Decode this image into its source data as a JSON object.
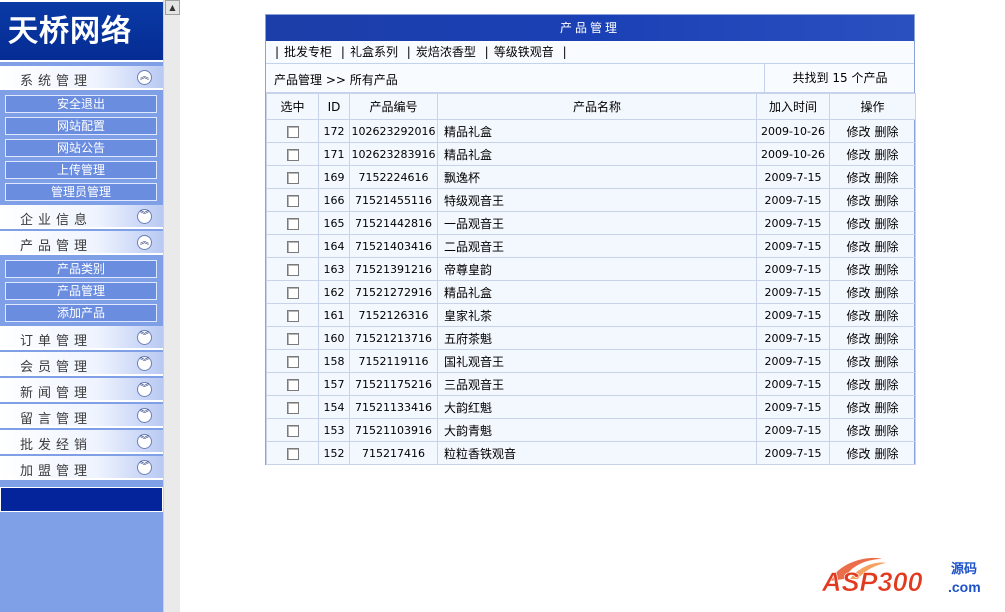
{
  "sidebar": {
    "logo": "天桥网络",
    "sections": [
      {
        "label": "系统管理",
        "toggle": "up"
      },
      {
        "label": "企业信息",
        "toggle": "down"
      },
      {
        "label": "产品管理",
        "toggle": "up"
      },
      {
        "label": "订单管理",
        "toggle": "down"
      },
      {
        "label": "会员管理",
        "toggle": "down"
      },
      {
        "label": "新闻管理",
        "toggle": "down"
      },
      {
        "label": "留言管理",
        "toggle": "down"
      },
      {
        "label": "批发经销",
        "toggle": "down"
      },
      {
        "label": "加盟管理",
        "toggle": "down"
      }
    ],
    "system_items": [
      "安全退出",
      "网站配置",
      "网站公告",
      "上传管理",
      "管理员管理"
    ],
    "product_items": [
      "产品类别",
      "产品管理",
      "添加产品"
    ]
  },
  "panel": {
    "title": "产品管理",
    "categories": [
      "批发专柜",
      "礼盒系列",
      "炭焙浓香型",
      "等级铁观音"
    ],
    "category_sep": "|",
    "breadcrumb": "产品管理 >> 所有产品",
    "count_text": "共找到 15 个产品"
  },
  "table": {
    "headers": [
      "选中",
      "ID",
      "产品编号",
      "产品名称",
      "加入时间",
      "操作"
    ],
    "edit_label": "修改",
    "delete_label": "删除",
    "rows": [
      {
        "id": "172",
        "code": "102623292016",
        "name": "精品礼盒",
        "date": "2009-10-26"
      },
      {
        "id": "171",
        "code": "102623283916",
        "name": "精品礼盒",
        "date": "2009-10-26"
      },
      {
        "id": "169",
        "code": "7152224616",
        "name": "飘逸杯",
        "date": "2009-7-15"
      },
      {
        "id": "166",
        "code": "71521455116",
        "name": "特级观音王",
        "date": "2009-7-15"
      },
      {
        "id": "165",
        "code": "71521442816",
        "name": "一品观音王",
        "date": "2009-7-15"
      },
      {
        "id": "164",
        "code": "71521403416",
        "name": "二品观音王",
        "date": "2009-7-15"
      },
      {
        "id": "163",
        "code": "71521391216",
        "name": "帝尊皇韵",
        "date": "2009-7-15"
      },
      {
        "id": "162",
        "code": "71521272916",
        "name": "精品礼盒",
        "date": "2009-7-15"
      },
      {
        "id": "161",
        "code": "7152126316",
        "name": "皇家礼茶",
        "date": "2009-7-15"
      },
      {
        "id": "160",
        "code": "71521213716",
        "name": "五府茶魁",
        "date": "2009-7-15"
      },
      {
        "id": "158",
        "code": "7152119116",
        "name": "国礼观音王",
        "date": "2009-7-15"
      },
      {
        "id": "157",
        "code": "71521175216",
        "name": "三品观音王",
        "date": "2009-7-15"
      },
      {
        "id": "154",
        "code": "71521133416",
        "name": "大韵红魁",
        "date": "2009-7-15"
      },
      {
        "id": "153",
        "code": "71521103916",
        "name": "大韵青魁",
        "date": "2009-7-15"
      },
      {
        "id": "152",
        "code": "715217416",
        "name": "粒粒香铁观音",
        "date": "2009-7-15"
      }
    ]
  },
  "watermark": {
    "main": "ASP300",
    "sub": "源码",
    "domain": ".com"
  },
  "colors": {
    "sidebar_bg": "#7f9fe6",
    "nav_dark": "#052c93",
    "title_bar": "#1c3ea8"
  }
}
